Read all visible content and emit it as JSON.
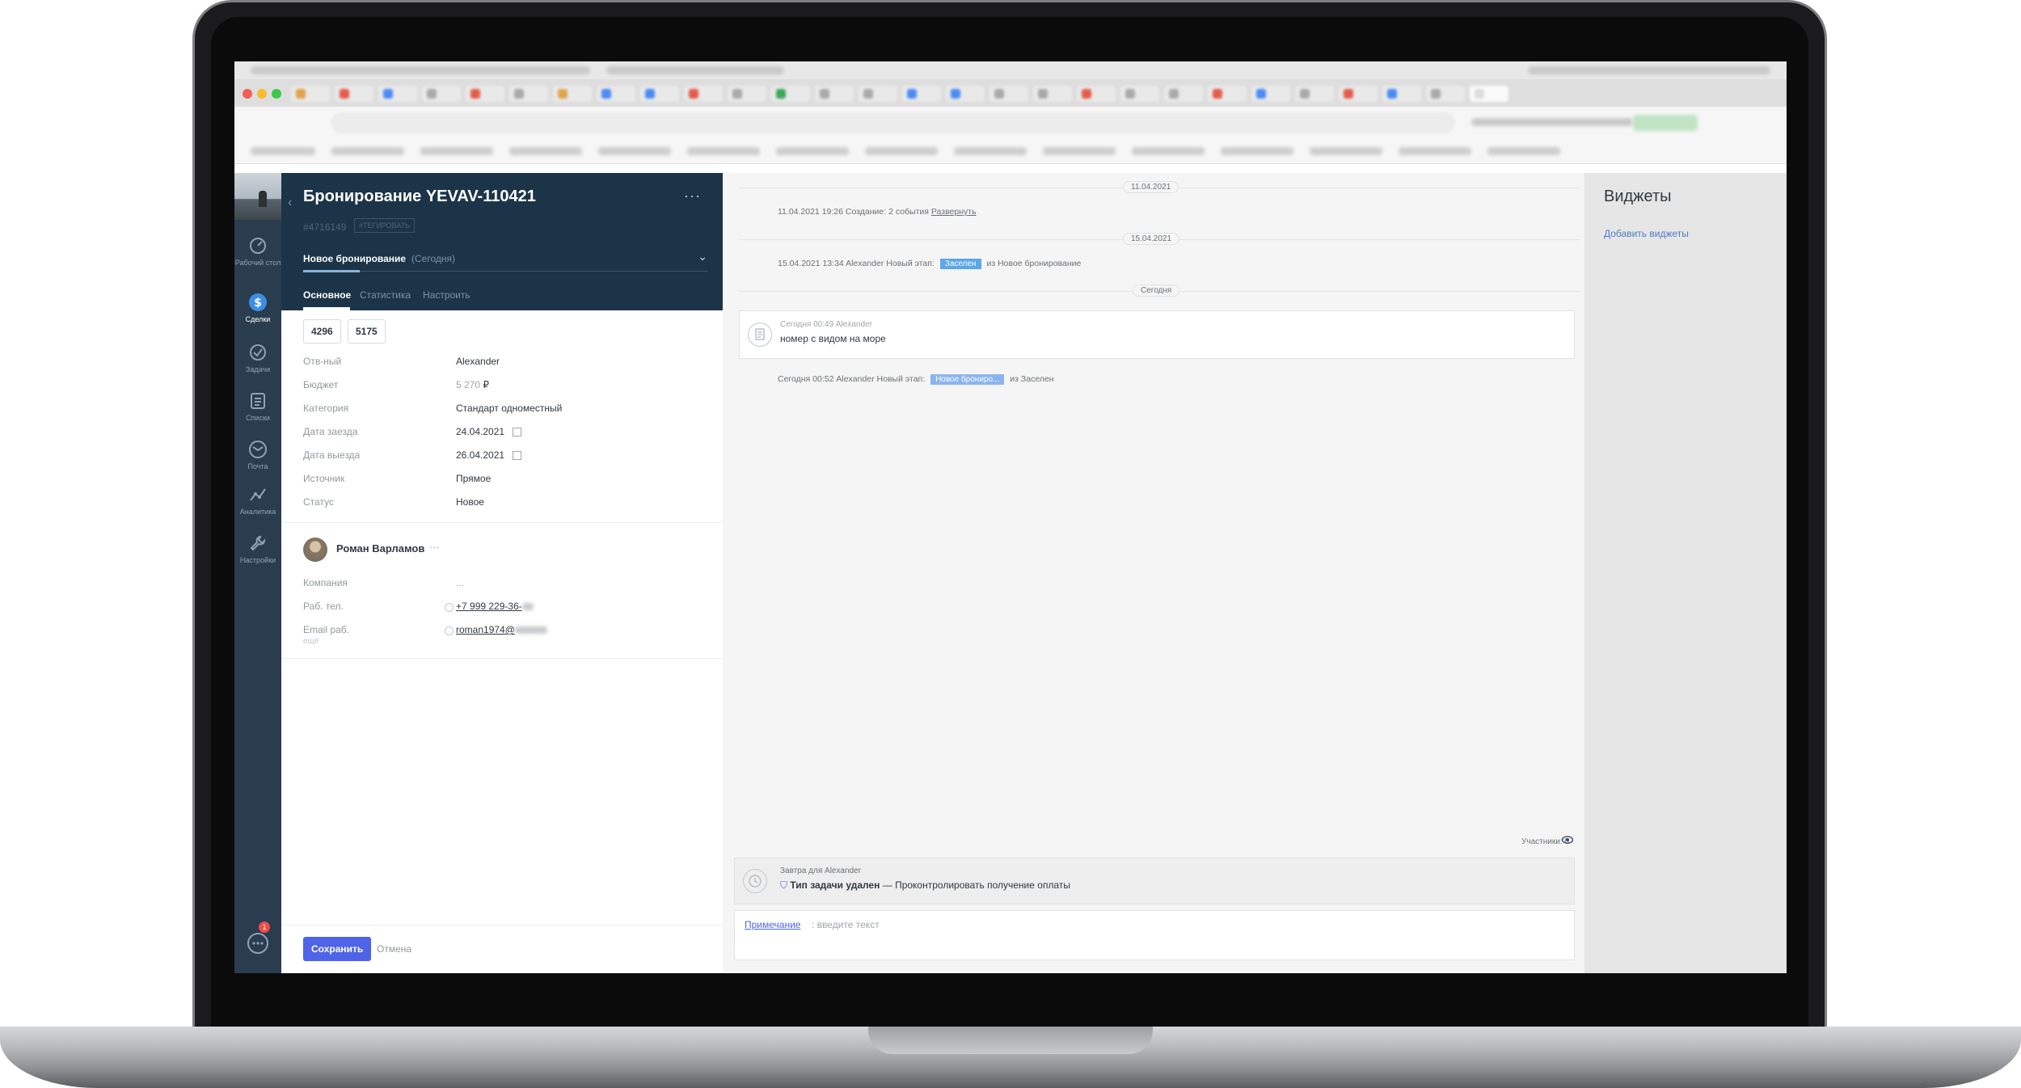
{
  "colors": {
    "nav_bg": "#2a3d4f",
    "card_header_bg": "#1c3448",
    "accent": "#4f63e8",
    "stage_settled": "#5aa7ea",
    "stage_new": "#8ab4f0",
    "badge_red": "#f04b4b"
  },
  "nav": {
    "items": [
      {
        "label": "Рабочий стол",
        "icon": "dashboard-icon"
      },
      {
        "label": "Сделки",
        "icon": "deals-icon",
        "active": true
      },
      {
        "label": "Задачи",
        "icon": "tasks-icon"
      },
      {
        "label": "Списки",
        "icon": "lists-icon"
      },
      {
        "label": "Почта",
        "icon": "mail-icon"
      },
      {
        "label": "Аналитика",
        "icon": "analytics-icon"
      },
      {
        "label": "Настройки",
        "icon": "settings-icon"
      }
    ],
    "chat_badge": "1"
  },
  "card": {
    "title": "Бронирование YEVAV-110421",
    "id": "#4716149",
    "tag_button": "#ТЕГИРОВАТЬ",
    "stage": "Новое бронирование",
    "stage_when": "(Сегодня)",
    "tabs": [
      "Основное",
      "Статистика",
      "Настроить"
    ],
    "pills": [
      "4296",
      "5175"
    ],
    "fields": [
      {
        "label": "Отв-ный",
        "value": "Alexander"
      },
      {
        "label": "Бюджет",
        "value": "5 270",
        "suffix": "₽"
      },
      {
        "label": "Категория",
        "value": "Стандарт одноместный"
      },
      {
        "label": "Дата заезда",
        "value": "24.04.2021"
      },
      {
        "label": "Дата выезда",
        "value": "26.04.2021"
      },
      {
        "label": "Источник",
        "value": "Прямое"
      },
      {
        "label": "Статус",
        "value": "Новое"
      }
    ],
    "contact": {
      "name": "Роман Варламов",
      "more": "···",
      "fields": [
        {
          "label": "Компания",
          "value": "..."
        },
        {
          "label": "Раб. тел.",
          "value": "+7 999 229-36-"
        },
        {
          "label": "Email раб.",
          "value": "roman1974@"
        }
      ],
      "add_more": "ещё"
    },
    "save_label": "Сохранить",
    "cancel_label": "Отмена"
  },
  "feed": {
    "dates": [
      "11.04.2021",
      "15.04.2021",
      "Сегодня"
    ],
    "event1": {
      "text": "11.04.2021 19:26 Создание: 2 события",
      "link": "Развернуть"
    },
    "event2": {
      "prefix": "15.04.2021 13:34 Alexander  Новый этап:",
      "tag": "Заселен",
      "suffix": "из Новое бронирование"
    },
    "note": {
      "meta": "Сегодня 00:49 Alexander",
      "text": "номер с видом на море"
    },
    "event3": {
      "prefix": "Сегодня 00:52 Alexander  Новый этап:",
      "tag": "Новое брониро...",
      "suffix": "из Заселен"
    },
    "participants": "Участники: 0",
    "task": {
      "meta": "Завтра для Alexander",
      "type": "Тип задачи удален",
      "text": " — Проконтролировать получение оплаты"
    },
    "composer": {
      "type": "Примечание",
      "placeholder": ": введите текст"
    }
  },
  "widgets": {
    "title": "Виджеты",
    "add_link": "Добавить виджеты"
  }
}
